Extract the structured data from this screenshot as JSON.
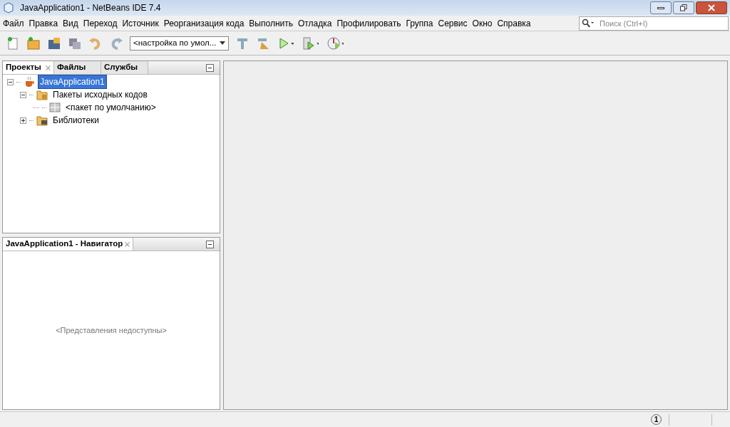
{
  "window": {
    "title": "JavaApplication1 - NetBeans IDE 7.4"
  },
  "menu": [
    "Файл",
    "Правка",
    "Вид",
    "Переход",
    "Источник",
    "Реорганизация кода",
    "Выполнить",
    "Отладка",
    "Профилировать",
    "Группа",
    "Сервис",
    "Окно",
    "Справка"
  ],
  "search": {
    "placeholder": "Поиск (Ctrl+I)"
  },
  "toolbar": {
    "config": "<настройка по умол..."
  },
  "projects_panel": {
    "tabs": [
      {
        "label": "Проекты",
        "selected": true
      },
      {
        "label": "Файлы",
        "selected": false
      },
      {
        "label": "Службы",
        "selected": false
      }
    ],
    "tree": [
      {
        "label": "JavaApplication1",
        "kind": "project",
        "selected": true,
        "expanded": true,
        "children": [
          {
            "label": "Пакеты исходных кодов",
            "kind": "folder",
            "selected": false,
            "expanded": true,
            "children": [
              {
                "label": "<пакет по умолчанию>",
                "kind": "package",
                "selected": false
              }
            ]
          },
          {
            "label": "Библиотеки",
            "kind": "library",
            "selected": false,
            "expanded": false
          }
        ]
      }
    ]
  },
  "navigator_panel": {
    "title": "JavaApplication1 - Навигатор",
    "message": "<Представления недоступны>"
  },
  "status_bar": {
    "notifications": "1"
  }
}
